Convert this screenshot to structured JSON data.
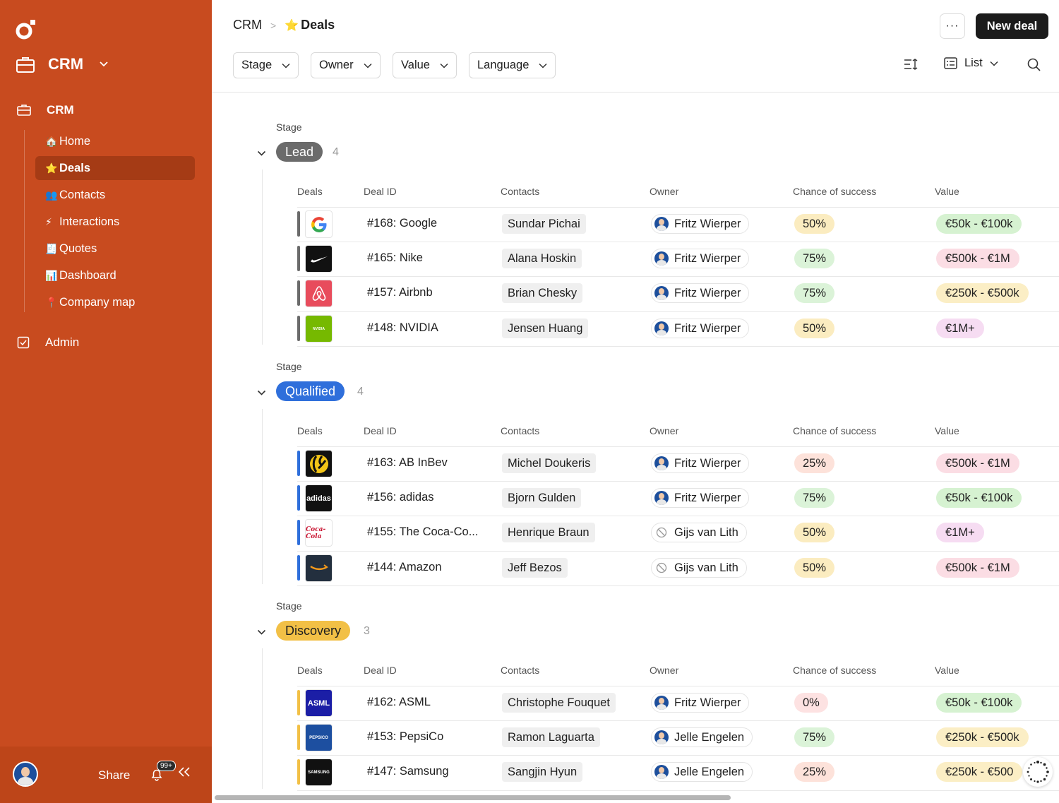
{
  "sidebar": {
    "workspace": "CRM",
    "section": "CRM",
    "items": [
      {
        "emoji": "🏠",
        "label": "Home"
      },
      {
        "emoji": "⭐",
        "label": "Deals"
      },
      {
        "emoji": "👥",
        "label": "Contacts"
      },
      {
        "emoji": "⚡",
        "label": "Interactions"
      },
      {
        "emoji": "🧾",
        "label": "Quotes"
      },
      {
        "emoji": "📊",
        "label": "Dashboard"
      },
      {
        "emoji": "📍",
        "label": "Company map"
      }
    ],
    "admin": "Admin",
    "share": "Share",
    "notifications": "99+"
  },
  "header": {
    "crumb_root": "CRM",
    "crumb_emoji": "⭐",
    "crumb_current": "Deals",
    "more": "···",
    "new_deal": "New deal"
  },
  "filters": [
    "Stage",
    "Owner",
    "Value",
    "Language"
  ],
  "view": {
    "label": "List"
  },
  "columns": [
    "Deals",
    "Deal ID",
    "Contacts",
    "Owner",
    "Chance of success",
    "Value"
  ],
  "stage_label": "Stage",
  "groups": [
    {
      "stage": "Lead",
      "count": "4",
      "color": "#6b6b6b",
      "rows": [
        {
          "logo": "google",
          "id": "#168: Google",
          "contact": "Sundar Pichai",
          "owner": "Fritz Wierper",
          "owner_avatar": true,
          "chance": "50%",
          "value": "€50k - €100k"
        },
        {
          "logo": "nike",
          "id": "#165: Nike",
          "contact": "Alana Hoskin",
          "owner": "Fritz Wierper",
          "owner_avatar": true,
          "chance": "75%",
          "value": "€500k - €1M"
        },
        {
          "logo": "airbnb",
          "id": "#157: Airbnb",
          "contact": "Brian Chesky",
          "owner": "Fritz Wierper",
          "owner_avatar": true,
          "chance": "75%",
          "value": "€250k - €500k"
        },
        {
          "logo": "nvidia",
          "id": "#148: NVIDIA",
          "contact": "Jensen Huang",
          "owner": "Fritz Wierper",
          "owner_avatar": true,
          "chance": "50%",
          "value": "€1M+"
        }
      ]
    },
    {
      "stage": "Qualified",
      "count": "4",
      "color": "#2f6fdb",
      "rows": [
        {
          "logo": "abinbev",
          "id": "#163: AB InBev",
          "contact": "Michel Doukeris",
          "owner": "Fritz Wierper",
          "owner_avatar": true,
          "chance": "25%",
          "value": "€500k - €1M"
        },
        {
          "logo": "adidas",
          "id": "#156: adidas",
          "contact": "Bjorn Gulden",
          "owner": "Fritz Wierper",
          "owner_avatar": true,
          "chance": "75%",
          "value": "€50k - €100k"
        },
        {
          "logo": "cocacola",
          "id": "#155: The Coca-Co...",
          "contact": "Henrique Braun",
          "owner": "Gijs van Lith",
          "owner_avatar": false,
          "chance": "50%",
          "value": "€1M+"
        },
        {
          "logo": "amazon",
          "id": "#144: Amazon",
          "contact": "Jeff Bezos",
          "owner": "Gijs van Lith",
          "owner_avatar": false,
          "chance": "50%",
          "value": "€500k - €1M"
        }
      ]
    },
    {
      "stage": "Discovery",
      "count": "3",
      "color": "#f2c046",
      "rows": [
        {
          "logo": "asml",
          "id": "#162: ASML",
          "contact": "Christophe Fouquet",
          "owner": "Fritz Wierper",
          "owner_avatar": true,
          "chance": "0%",
          "value": "€50k - €100k"
        },
        {
          "logo": "pepsico",
          "id": "#153: PepsiCo",
          "contact": "Ramon Laguarta",
          "owner": "Jelle Engelen",
          "owner_avatar": true,
          "chance": "75%",
          "value": "€250k - €500k"
        },
        {
          "logo": "samsung",
          "id": "#147: Samsung",
          "contact": "Sangjin Hyun",
          "owner": "Jelle Engelen",
          "owner_avatar": true,
          "chance": "25%",
          "value": "€250k - €500"
        }
      ]
    }
  ],
  "logo_text": {
    "nvidia": "NVIDIA",
    "adidas": "adidas",
    "cocacola": "Coca-Cola",
    "asml": "ASML",
    "pepsico": "PEPSICO",
    "samsung": "SAMSUNG"
  },
  "chance_colors": {
    "50%": "#fbecc0",
    "75%": "#dbf3d8",
    "25%": "#fde2da",
    "0%": "#fde2e2"
  },
  "value_colors": {
    "€50k - €100k": "#d6f2d1",
    "€500k - €1M": "#fbdde4",
    "€250k - €500k": "#fbeec5",
    "€1M+": "#f6dcf2",
    "€250k - €500": "#fbeec5"
  }
}
